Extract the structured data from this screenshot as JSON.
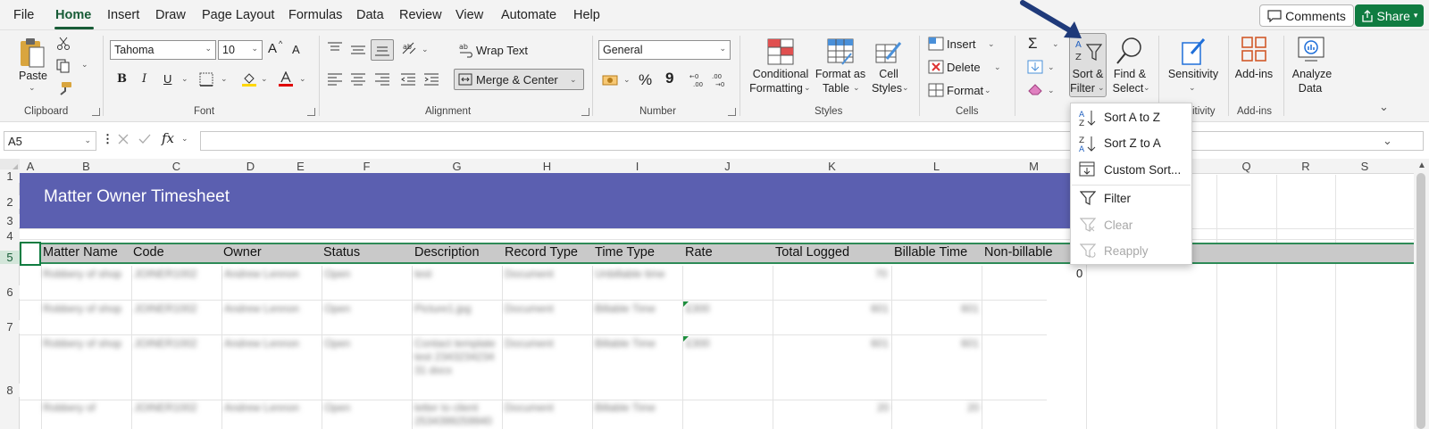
{
  "menu": {
    "file": "File",
    "home": "Home",
    "insert": "Insert",
    "draw": "Draw",
    "page_layout": "Page Layout",
    "formulas": "Formulas",
    "data": "Data",
    "review": "Review",
    "view": "View",
    "automate": "Automate",
    "help": "Help"
  },
  "top_buttons": {
    "comments": "Comments",
    "share": "Share"
  },
  "clipboard": {
    "paste": "Paste",
    "group": "Clipboard"
  },
  "font": {
    "name": "Tahoma",
    "size": "10",
    "group": "Font",
    "bold": "B",
    "italic": "I",
    "underline": "U",
    "grow": "A",
    "shrink": "A"
  },
  "alignment": {
    "wrap_text": "Wrap Text",
    "merge_center": "Merge & Center",
    "group": "Alignment"
  },
  "number": {
    "format": "General",
    "percent": "%",
    "comma": "9",
    "group": "Number"
  },
  "styles": {
    "conditional_1": "Conditional",
    "conditional_2": "Formatting",
    "format_table_1": "Format as",
    "format_table_2": "Table",
    "cell_styles_1": "Cell",
    "cell_styles_2": "Styles",
    "group": "Styles"
  },
  "cells": {
    "insert": "Insert",
    "delete": "Delete",
    "format": "Format",
    "group": "Cells"
  },
  "editing": {
    "sort_filter_1": "Sort &",
    "sort_filter_2": "Filter",
    "find_select_1": "Find &",
    "find_select_2": "Select"
  },
  "sensitivity": {
    "label": "Sensitivity",
    "group_partial": "itivity"
  },
  "addins": {
    "label": "Add-ins",
    "group": "Add-ins"
  },
  "analyze": {
    "label_1": "Analyze",
    "label_2": "Data"
  },
  "formula_bar": {
    "name_box": "A5",
    "fx": "fx",
    "value": ""
  },
  "columns": [
    "A",
    "B",
    "C",
    "D",
    "E",
    "F",
    "G",
    "H",
    "I",
    "J",
    "K",
    "L",
    "M",
    "Q",
    "R",
    "S"
  ],
  "rows": [
    "1",
    "2",
    "3",
    "4",
    "5",
    "6",
    "7",
    "8"
  ],
  "sheet": {
    "title": "Matter Owner Timesheet",
    "headers": [
      "Matter Name",
      "Code",
      "Owner",
      "Status",
      "Description",
      "Record Type",
      "Time Type",
      "Rate",
      "Total Logged",
      "Billable Time",
      "Non-billable"
    ],
    "n6_value": "0",
    "rows": [
      [
        "Robbery of shop",
        "JOINER1002",
        "Andrew Lennon",
        "Open",
        "test",
        "Document",
        "Unbillable time",
        "",
        "70",
        "",
        ""
      ],
      [
        "Robbery of shop",
        "JOINER1002",
        "Andrew Lennon",
        "Open",
        "Picture1.jpg",
        "Document",
        "Billable Time",
        "£300",
        "601",
        "601",
        ""
      ],
      [
        "Robbery of shop",
        "JOINER1002",
        "Andrew Lennon",
        "Open",
        "Contact template test 2343234234 31 docx",
        "Document",
        "Billable Time",
        "£300",
        "601",
        "601",
        ""
      ],
      [
        "Robbery of",
        "JOINER1002",
        "Andrew Lennon",
        "Open",
        "letter to client 2534399259940",
        "Document",
        "Billable Time",
        "",
        "20",
        "20",
        ""
      ]
    ]
  },
  "sort_menu": {
    "sort_az": "Sort A to Z",
    "sort_za": "Sort Z to A",
    "custom_sort": "Custom Sort...",
    "filter": "Filter",
    "clear": "Clear",
    "reapply": "Reapply"
  },
  "colors": {
    "accent": "#185c37",
    "share": "#107c41",
    "title_band": "#5b5fb0",
    "header_band": "#c9c9c9",
    "arrow": "#1f3a7a"
  }
}
